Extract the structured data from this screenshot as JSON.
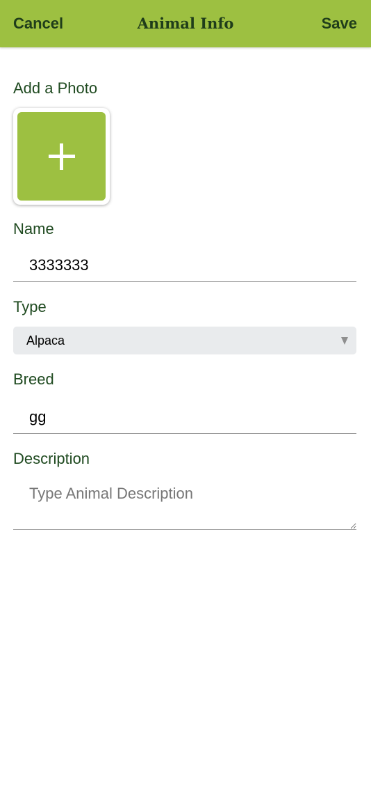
{
  "header": {
    "cancel_label": "Cancel",
    "title": "Animal Info",
    "save_label": "Save"
  },
  "photo": {
    "label": "Add a Photo",
    "icon": "plus-icon"
  },
  "name": {
    "label": "Name",
    "value": "3333333"
  },
  "type": {
    "label": "Type",
    "selected": "Alpaca"
  },
  "breed": {
    "label": "Breed",
    "value": "gg"
  },
  "description": {
    "label": "Description",
    "placeholder": "Type Animal Description",
    "value": ""
  },
  "colors": {
    "accent": "#9dc041",
    "header_text": "#1f3d1a",
    "label_text": "#1f4a20",
    "select_bg": "#e9ebed"
  }
}
